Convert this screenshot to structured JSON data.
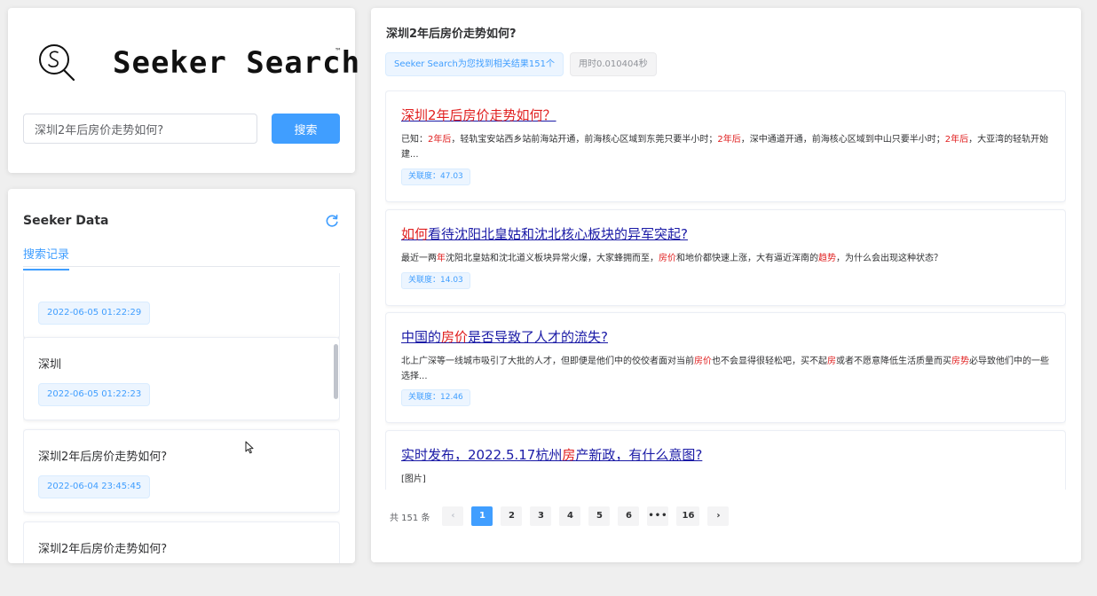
{
  "logo": {
    "text": "Seeker Search",
    "tm": "™"
  },
  "search": {
    "value": "深圳2年后房价走势如何?",
    "button_label": "搜索"
  },
  "data_panel": {
    "title": "Seeker Data",
    "tab_label": "搜索记录",
    "history": [
      {
        "query": "",
        "time": "2022-06-05 01:22:29"
      },
      {
        "query": "深圳",
        "time": "2022-06-05 01:22:23"
      },
      {
        "query": "深圳2年后房价走势如何?",
        "time": "2022-06-04 23:45:45"
      },
      {
        "query": "深圳2年后房价走势如何?",
        "time": ""
      }
    ]
  },
  "results_header": {
    "query": "深圳2年后房价走势如何?",
    "found": "Seeker Search为您找到相关结果151个",
    "elapsed": "用时0.010404秒"
  },
  "results": [
    {
      "title_html": "<span class=\"hl\">深圳2年后房价走势如何？</span>",
      "snippet_html": "已知：<span class=\"hl\">2年后</span>，轻轨宝安站西乡站前海站开通，前海核心区域到东莞只要半小时；<span class=\"hl\">2年后</span>，深中通道开通，前海核心区域到中山只要半小时；<span class=\"hl\">2年后</span>，大亚湾的轻轨开始建...",
      "score": "关联度：47.03"
    },
    {
      "title_html": "<span class=\"hl\">如何</span>看待沈阳北皇姑和沈北核心板块的异军突起?",
      "snippet_html": "最近一两<span class=\"hl\">年</span>沈阳北皇姑和沈北道义板块异常火爆，大家蜂拥而至，<span class=\"hl\">房价</span>和地价都快速上涨，大有逼近浑南的<span class=\"hl\">趋势</span>，为什么会出现这种状态？",
      "score": "关联度：14.03"
    },
    {
      "title_html": "中国的<span class=\"hl\">房价</span>是否导致了人才的流失?",
      "snippet_html": "北上广深等一线城市吸引了大批的人才，但即便是他们中的佼佼者面对当前<span class=\"hl\">房价</span>也不会显得很轻松吧，买不起<span class=\"hl\">房</span>或者不愿意降低生活质量而买<span class=\"hl\">房</span><span class=\"hl\">势</span>必导致他们中的一些选择...",
      "score": "关联度：12.46"
    },
    {
      "title_html": "实时发布，2022.5.17杭州<span class=\"hl\">房</span>产新政，有什么意图?",
      "snippet_html": "[图片]",
      "score": ""
    }
  ],
  "pagination": {
    "total": "共 151 条",
    "pages": [
      "1",
      "2",
      "3",
      "4",
      "5",
      "6",
      "•••",
      "16"
    ],
    "current": "1",
    "prev": "‹",
    "next": "›"
  },
  "colors": {
    "accent": "#409eff",
    "highlight": "#e02020",
    "link": "#1a1aa6"
  }
}
